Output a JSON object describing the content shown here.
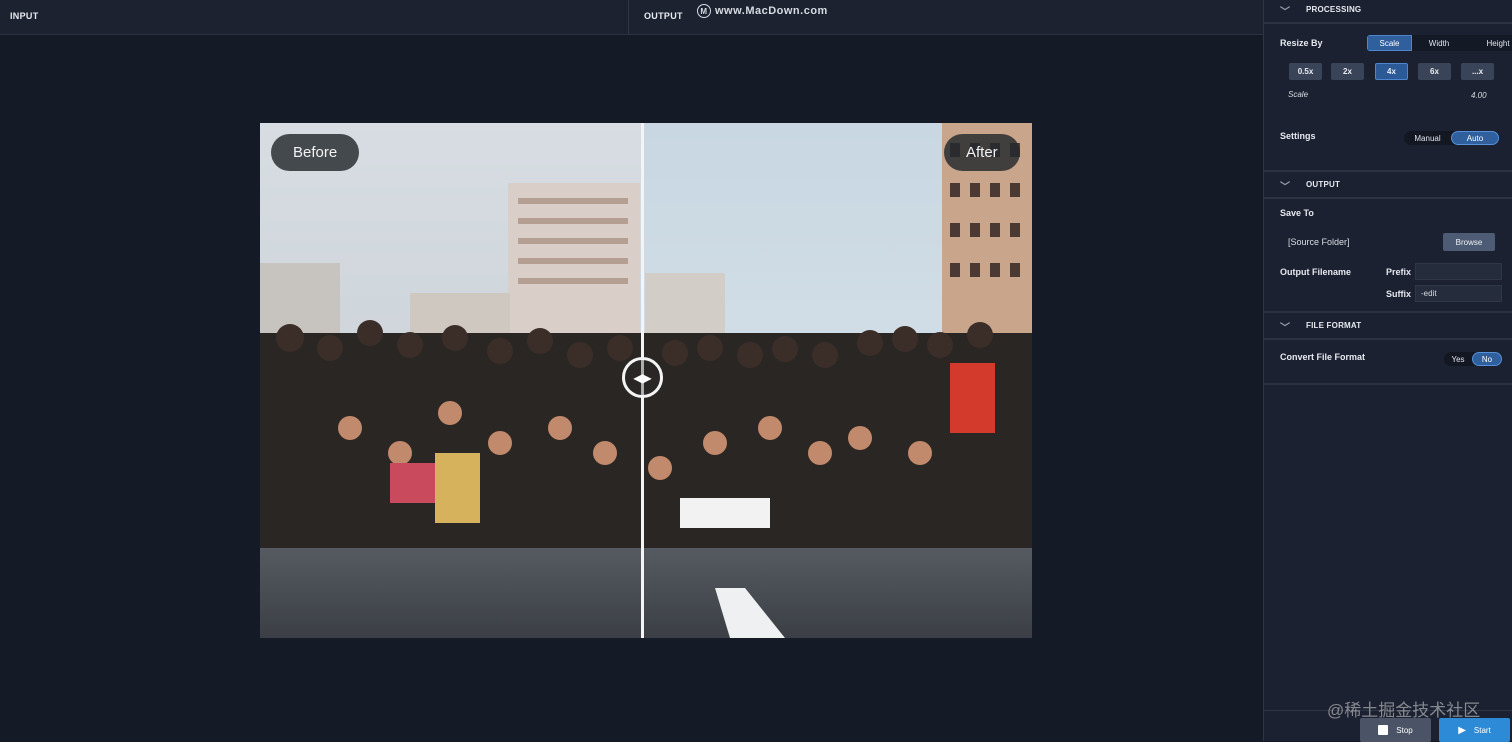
{
  "topbar": {
    "input_label": "INPUT",
    "output_label": "OUTPUT",
    "watermark": "www.MacDown.com"
  },
  "compare": {
    "before_label": "Before",
    "after_label": "After"
  },
  "processing": {
    "title": "PROCESSING",
    "resize_by_label": "Resize By",
    "resize_modes": [
      "Scale",
      "Width",
      "Height"
    ],
    "resize_selected": "Scale",
    "scale_chips": [
      "0.5x",
      "2x",
      "4x",
      "6x",
      "...x"
    ],
    "scale_selected": "4x",
    "scale_label": "Scale",
    "scale_value": "4.00",
    "settings_label": "Settings",
    "settings_options": [
      "Manual",
      "Auto"
    ],
    "settings_selected": "Auto"
  },
  "output": {
    "title": "OUTPUT",
    "save_to_label": "Save To",
    "folder": "[Source Folder]",
    "browse_label": "Browse",
    "filename_label": "Output Filename",
    "prefix_label": "Prefix",
    "prefix_value": "",
    "suffix_label": "Suffix",
    "suffix_value": "-edit"
  },
  "file_format": {
    "title": "FILE FORMAT",
    "convert_label": "Convert File Format",
    "options": [
      "Yes",
      "No"
    ],
    "selected": "No"
  },
  "footer": {
    "stop_label": "Stop",
    "start_label": "Start"
  },
  "bottom_watermark": "@稀土掘金技术社区",
  "colors": {
    "accent": "#2d8ad6",
    "selected": "#2f5f9d",
    "panel": "#1b2130",
    "background": "#141824"
  }
}
